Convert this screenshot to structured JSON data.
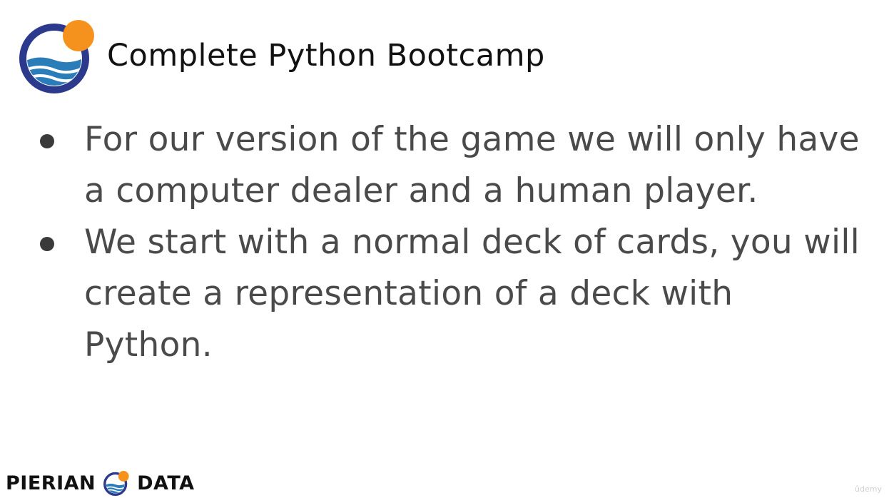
{
  "header": {
    "course_title": "Complete Python Bootcamp"
  },
  "bullets": [
    "For our version of the game we will only have a computer dealer and a human player.",
    "We start with a normal deck of cards, you will create a representation of a deck with Python."
  ],
  "footer": {
    "brand_left": "PIERIAN",
    "brand_right": "DATA"
  },
  "watermark": "ûdemy",
  "colors": {
    "logo_ring": "#2b3a8c",
    "logo_sun": "#f5921e",
    "logo_wave": "#2a7db8",
    "text_dark": "#111111",
    "text_body": "#4a4a4a"
  },
  "icons": {
    "header_logo": "pierian-data-logo-icon",
    "footer_logo": "pierian-data-logo-icon"
  }
}
